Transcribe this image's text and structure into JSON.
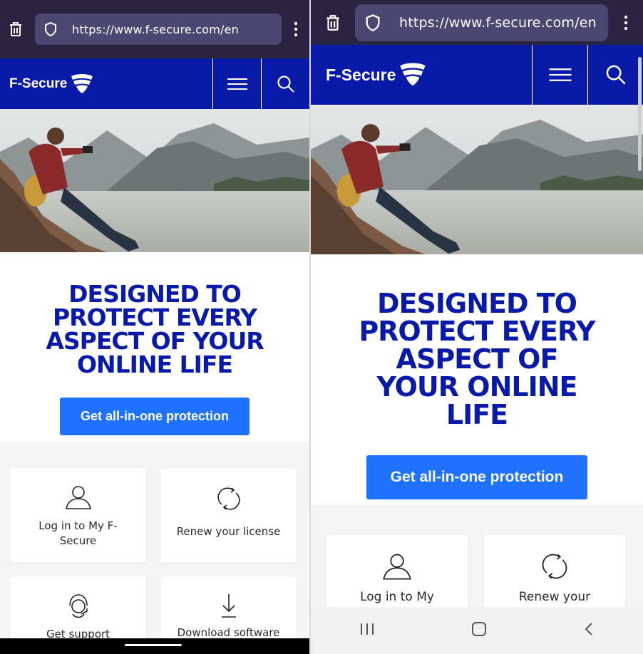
{
  "browser": {
    "url": "https://www.f-secure.com/en"
  },
  "site": {
    "brand": "F-Secure",
    "headline_left": "DESIGNED TO PROTECT EVERY ASPECT OF YOUR ONLINE LIFE",
    "headline_right": "DESIGNED TO PROTECT EVERY ASPECT OF YOUR ONLINE LIFE",
    "cta_label": "Get all-in-one protection"
  },
  "cards": {
    "login": "Log in to My F-Secure",
    "renew": "Renew your license",
    "support": "Get support",
    "download": "Download software"
  },
  "cards_right": {
    "login": "Log in to My",
    "renew": "Renew your"
  },
  "colors": {
    "brand_blue": "#0a1aa8",
    "cta_blue": "#1e72ff",
    "chrome": "#2a2342"
  }
}
